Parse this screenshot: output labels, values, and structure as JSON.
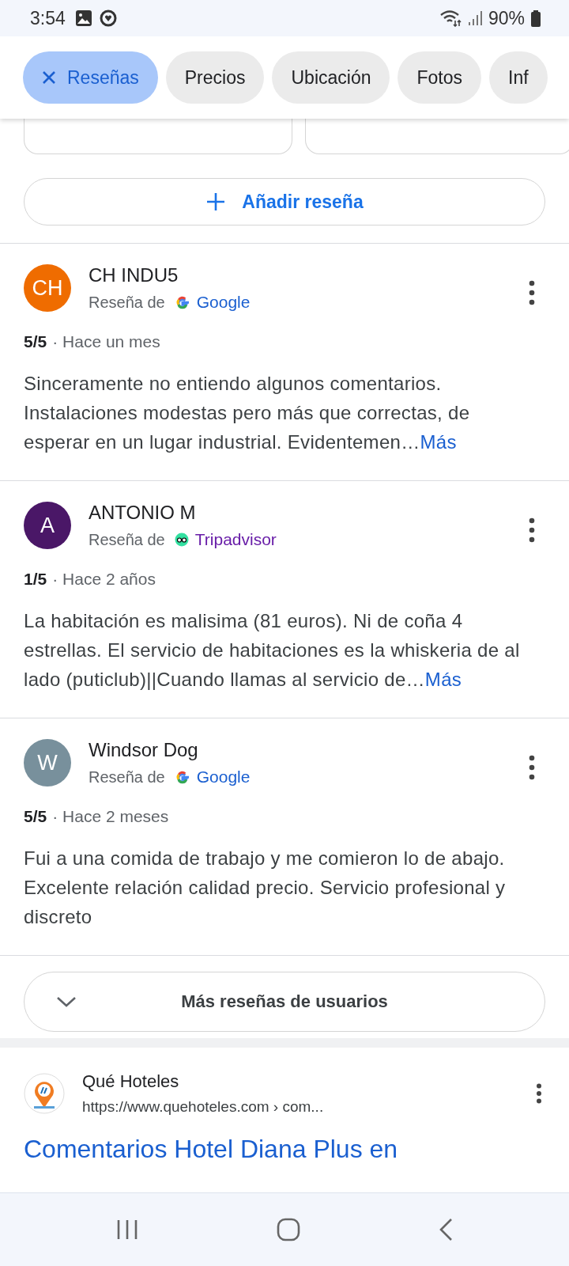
{
  "status_bar": {
    "time": "3:54",
    "battery": "90%"
  },
  "filter_chips": [
    {
      "label": "Reseñas",
      "selected": true
    },
    {
      "label": "Precios",
      "selected": false
    },
    {
      "label": "Ubicación",
      "selected": false
    },
    {
      "label": "Fotos",
      "selected": false
    },
    {
      "label": "Inf",
      "selected": false
    }
  ],
  "add_review_button": "Añadir reseña",
  "reviews": [
    {
      "initials": "CH",
      "color": "#ef6c00",
      "author": "CH INDU5",
      "source_prefix": "Reseña de",
      "source": "Google",
      "kind": "google",
      "rating": "5/5",
      "time": "· Hace un mes",
      "text": "Sinceramente no entiendo algunos comentarios. Instalaciones modestas pero más que correctas, de esperar en un lugar industrial. Evidentemen…",
      "more": "Más"
    },
    {
      "initials": "A",
      "color": "#4a1767",
      "author": "ANTONIO M",
      "source_prefix": "Reseña de",
      "source": "Tripadvisor",
      "kind": "tripadvisor",
      "rating": "1/5",
      "time": "· Hace 2 años",
      "text": "La habitación es malisima (81 euros). Ni de coña 4 estrellas. El servicio de habitaciones es la whiskeria de al lado (puticlub)||Cuando llamas al servicio de…",
      "more": "Más"
    },
    {
      "initials": "W",
      "color": "#78909c",
      "author": "Windsor Dog",
      "source_prefix": "Reseña de",
      "source": "Google",
      "kind": "google",
      "rating": "5/5",
      "time": "· Hace 2 meses",
      "text": "Fui a una comida de trabajo y me comieron lo de abajo. Excelente relación calidad precio. Servicio profesional y discreto"
    }
  ],
  "more_reviews_button": "Más reseñas de usuarios",
  "search_result": {
    "site": "Qué Hoteles",
    "url": "https://www.quehoteles.com › com...",
    "title": "Comentarios Hotel Diana Plus en"
  }
}
